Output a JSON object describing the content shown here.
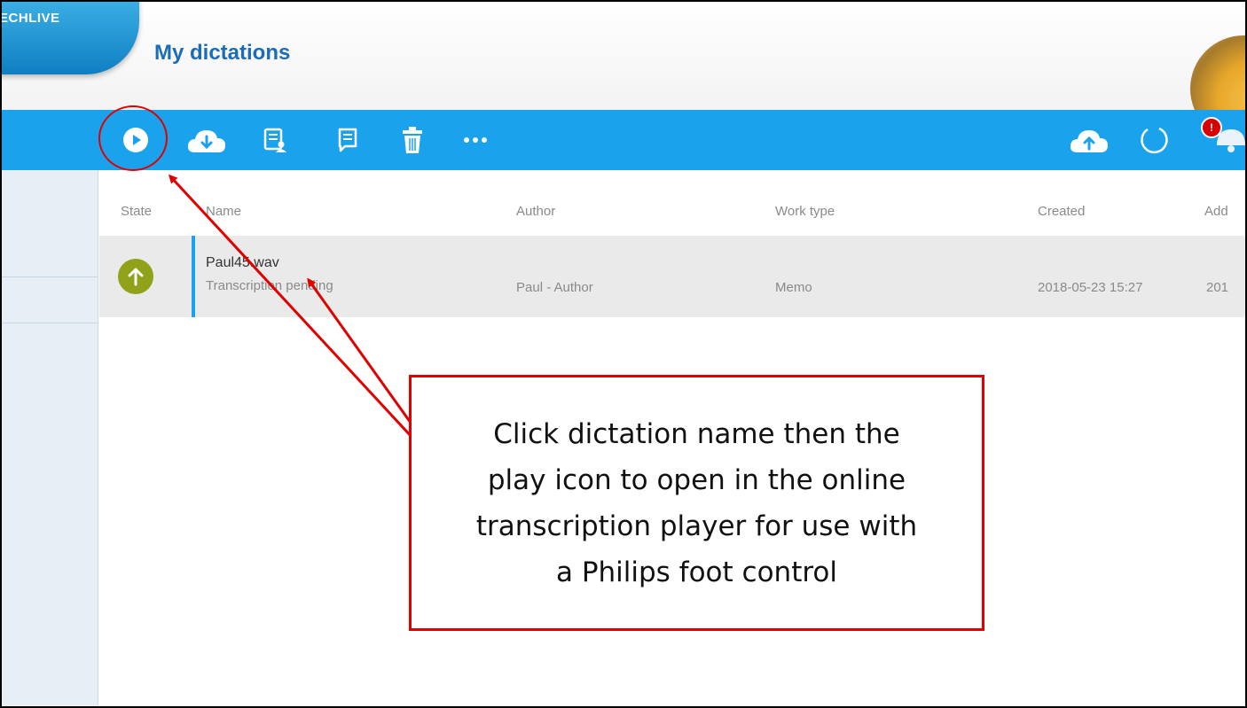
{
  "app": {
    "logo_text": "PEECHLIVE",
    "page_title": "My dictations"
  },
  "toolbar": {
    "left_icons": [
      "play-icon",
      "download-cloud-icon",
      "assign-document-icon",
      "document-icon",
      "trash-icon",
      "more-icon"
    ],
    "right_icons": [
      "upload-cloud-icon",
      "refresh-icon",
      "notification-icon"
    ],
    "notification_count": "!"
  },
  "table": {
    "columns": [
      "State",
      "Name",
      "Author",
      "Work type",
      "Created",
      "Add"
    ],
    "rows": [
      {
        "state_icon": "upload-arrow-icon",
        "name": "Paul45.wav",
        "status": "Transcription pending",
        "author": "Paul - Author",
        "work_type": "Memo",
        "created": "2018-05-23 15:27",
        "added": "201"
      }
    ]
  },
  "annotation": {
    "text": "Click dictation name then the\nplay icon to open in the online\ntranscription player for use with\na Philips foot control"
  },
  "colors": {
    "toolbar": "#1aa3ec",
    "title": "#1c6db8",
    "state_circle": "#8fa21a",
    "annotation": "#e00000",
    "sidebar": "#e7eef6"
  }
}
